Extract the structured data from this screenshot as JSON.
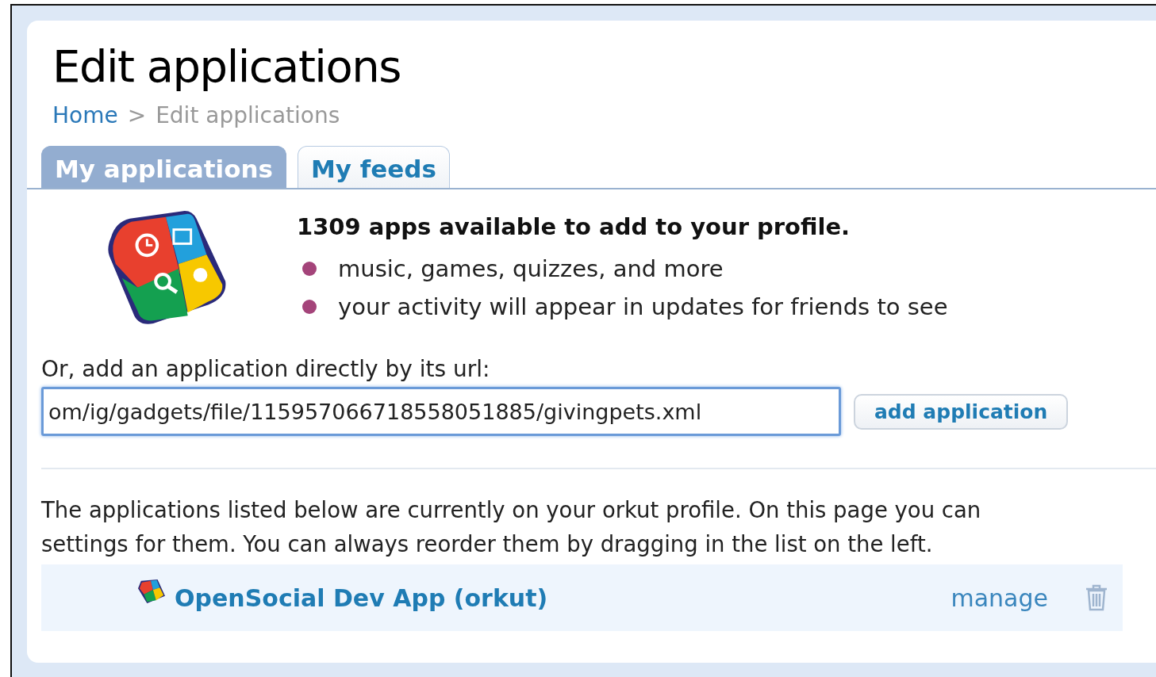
{
  "page": {
    "title": "Edit applications"
  },
  "breadcrumb": [
    {
      "label": "Home",
      "link": true
    },
    {
      "label": ">",
      "link": false
    },
    {
      "label": "Edit applications",
      "link": false
    }
  ],
  "tabs": [
    {
      "label": "My applications",
      "selected": true
    },
    {
      "label": "My feeds",
      "selected": false
    }
  ],
  "promo": {
    "headline": "1309 apps available to add to your profile.",
    "bullets": [
      "music, games, quizzes, and more",
      "your activity will appear in updates for friends to see"
    ]
  },
  "add_by_url": {
    "label": "Or, add an application directly by its url:",
    "value": "om/ig/gadgets/file/115957066718558051885/givingpets.xml",
    "button": "add application"
  },
  "intro": {
    "lines": [
      "The applications listed below are currently on your orkut profile. On this page you can",
      "settings for them. You can always reorder them by dragging in the list on the left."
    ]
  },
  "applications": [
    {
      "name": "OpenSocial Dev App (orkut)",
      "action": "manage"
    }
  ]
}
